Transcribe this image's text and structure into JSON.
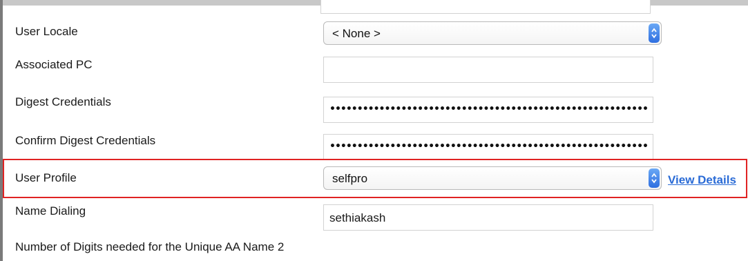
{
  "form": {
    "user_locale": {
      "label": "User Locale",
      "value": "< None >"
    },
    "associated_pc": {
      "label": "Associated PC",
      "value": ""
    },
    "digest_credentials": {
      "label": "Digest Credentials",
      "value": "••••••••••••••••••••••••••••••••••••••••••••••••••••••••••"
    },
    "confirm_digest_credentials": {
      "label": "Confirm Digest Credentials",
      "value": "••••••••••••••••••••••••••••••••••••••••••••••••••••••••••"
    },
    "user_profile": {
      "label": "User Profile",
      "value": "selfpro",
      "link": "View Details"
    },
    "name_dialing": {
      "label": "Name Dialing",
      "value": "sethiakash"
    },
    "unique_aa_digits": {
      "label": "Number of Digits needed for the Unique AA Name",
      "value": "2"
    }
  },
  "colors": {
    "highlight_border": "#e02222",
    "link": "#2a6bd6",
    "select_arrow": "#2f6fe0"
  },
  "icons": {
    "select_arrow": "updown-chevron-icon"
  }
}
